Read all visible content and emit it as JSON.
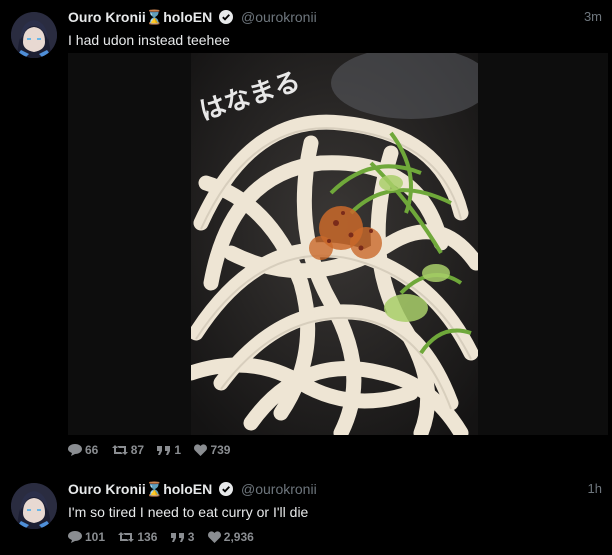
{
  "tweets": [
    {
      "author_name": "Ouro Kronii",
      "author_suffix": "holoEN",
      "handle": "@ourokronii",
      "time": "3m",
      "text": "I had udon instead teehee",
      "replies": "66",
      "retweets": "87",
      "quotes": "1",
      "likes": "739"
    },
    {
      "author_name": "Ouro Kronii",
      "author_suffix": "holoEN",
      "handle": "@ourokronii",
      "time": "1h",
      "text": "I'm so tired I need to eat curry or I'll die",
      "replies": "101",
      "retweets": "136",
      "quotes": "3",
      "likes": "2,936"
    }
  ],
  "photo_watermark": "はなまる",
  "colors": {
    "background": "#000000",
    "name": "#e7e9ea",
    "muted": "#6e767d",
    "hourglass": "#f5a53a",
    "verified": "#e7e9ea"
  },
  "icons": [
    "reply-icon",
    "retweet-icon",
    "quote-icon",
    "heart-icon",
    "verified-icon",
    "hourglass-icon"
  ]
}
